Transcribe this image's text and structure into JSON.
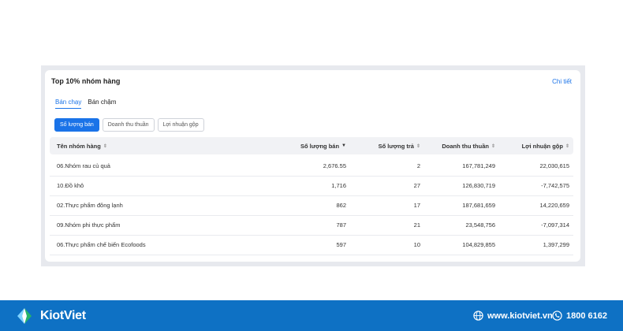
{
  "card": {
    "title": "Top 10% nhóm hàng",
    "detail_link": "Chi tiết",
    "tabs": [
      {
        "label": "Bán chạy",
        "active": true
      },
      {
        "label": "Bán chậm",
        "active": false
      }
    ],
    "metric_buttons": [
      {
        "label": "Số lượng bán",
        "active": true
      },
      {
        "label": "Doanh thu thuần",
        "active": false
      },
      {
        "label": "Lợi nhuận gộp",
        "active": false
      }
    ],
    "columns": [
      "Tên nhóm hàng",
      "Số lượng bán",
      "Số lượng trả",
      "Doanh thu thuần",
      "Lợi nhuận gộp"
    ],
    "rows": [
      [
        "06.Nhóm rau củ quả",
        "2,676.55",
        "2",
        "167,781,249",
        "22,030,615"
      ],
      [
        "10.Đồ khô",
        "1,716",
        "27",
        "126,830,719",
        "-7,742,575"
      ],
      [
        "02.Thực phẩm đông lạnh",
        "862",
        "17",
        "187,681,659",
        "14,220,659"
      ],
      [
        "09.Nhóm phi thực phẩm",
        "787",
        "21",
        "23,548,756",
        "-7,097,314"
      ],
      [
        "06.Thực phẩm chế biến Ecofoods",
        "597",
        "10",
        "104,829,855",
        "1,397,299"
      ]
    ]
  },
  "footer": {
    "brand": "KiotViet",
    "website": "www.kiotviet.vn",
    "phone": "1800 6162",
    "color": "#0e71c4"
  }
}
